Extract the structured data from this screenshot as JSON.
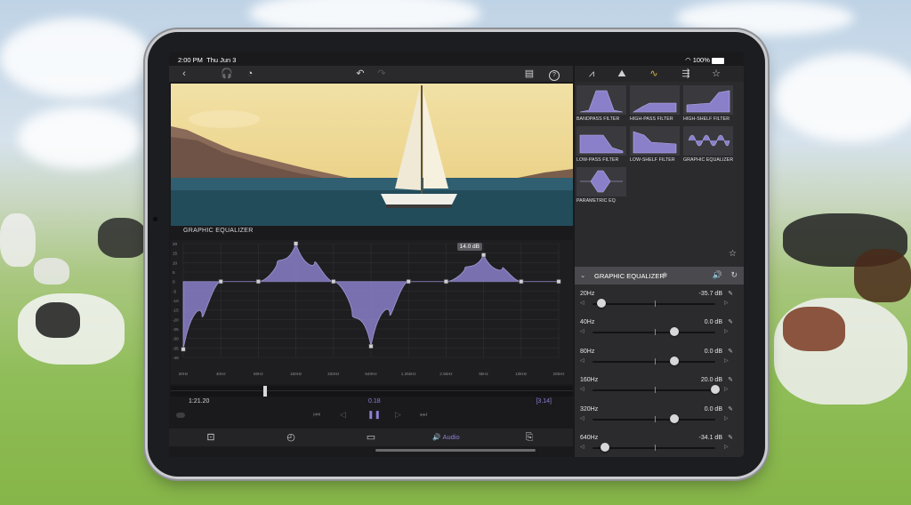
{
  "status": {
    "time": "2:00 PM",
    "date": "Thu Jun 3",
    "battery": "100%"
  },
  "editor": {
    "eq_label": "GRAPHIC EQUALIZER",
    "tooltip": "14.0 dB",
    "y_ticks": [
      "20",
      "15",
      "10",
      "5",
      "0",
      "-5",
      "-10",
      "-15",
      "-20",
      "-25",
      "-30",
      "-35",
      "-40"
    ],
    "x_ticks": [
      "20Hz",
      "40Hz",
      "80Hz",
      "160Hz",
      "320Hz",
      "640Hz",
      "1.25kHz",
      "2.5kHz",
      "5kHz",
      "10kHz",
      "20kHz"
    ],
    "gains": [
      -35.7,
      0.0,
      0.0,
      20.0,
      0.0,
      -34.1,
      0.0,
      0.0,
      14.0,
      0.0,
      0.0
    ],
    "timecode": "1:21.20",
    "playhead_value": "0.18",
    "duration": "[3.14]",
    "audio_tab": "Audio",
    "accent": "#8b7fd6",
    "fill": "#8a7fc9"
  },
  "filters": [
    {
      "name": "BANDPASS FILTER"
    },
    {
      "name": "HIGH-PASS FILTER"
    },
    {
      "name": "HIGH-SHELF FILTER"
    },
    {
      "name": "LOW-PASS FILTER"
    },
    {
      "name": "LOW-SHELF FILTER"
    },
    {
      "name": "GRAPHIC EQUALIZER"
    },
    {
      "name": "PARAMETRIC EQ"
    }
  ],
  "panel": {
    "title": "GRAPHIC EQUALIZER",
    "bands": [
      {
        "label": "20Hz",
        "value": "-35.7 dB",
        "gain": -35.7
      },
      {
        "label": "40Hz",
        "value": "0.0 dB",
        "gain": 0.0
      },
      {
        "label": "80Hz",
        "value": "0.0 dB",
        "gain": 0.0
      },
      {
        "label": "160Hz",
        "value": "20.0 dB",
        "gain": 20.0
      },
      {
        "label": "320Hz",
        "value": "0.0 dB",
        "gain": 0.0
      },
      {
        "label": "640Hz",
        "value": "-34.1 dB",
        "gain": -34.1
      },
      {
        "label": "1.25kHz",
        "value": "0.0 dB",
        "gain": 0.0
      }
    ]
  }
}
